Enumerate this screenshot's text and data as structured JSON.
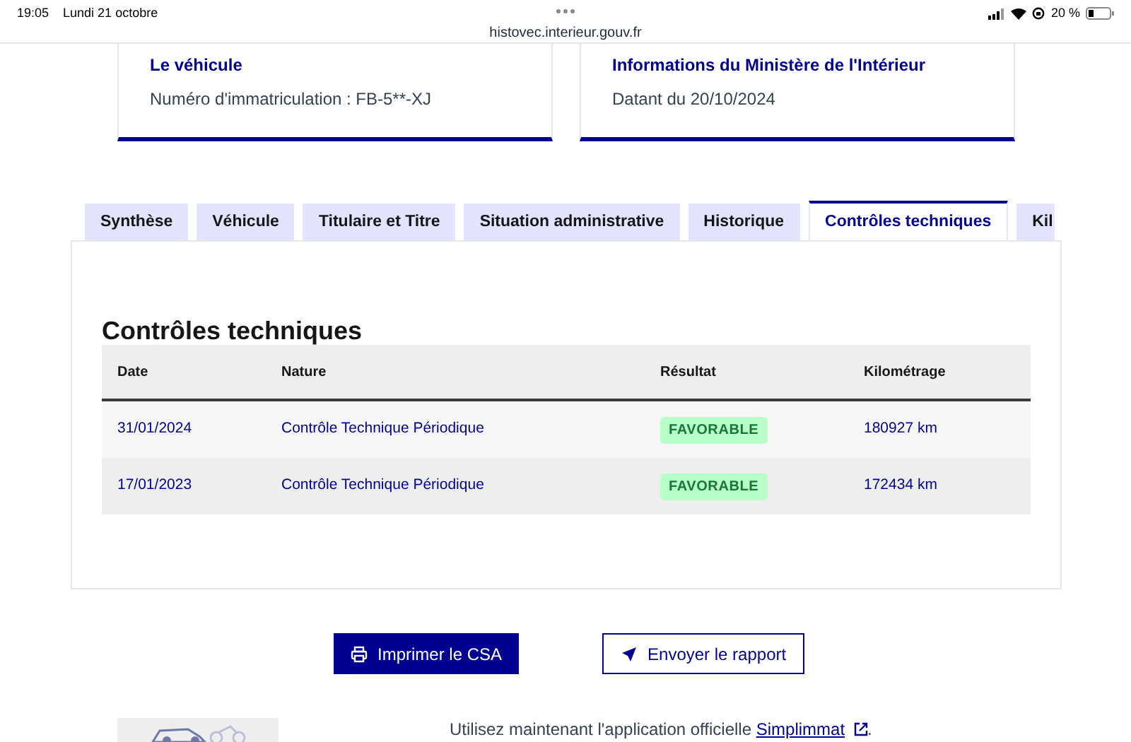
{
  "status_bar": {
    "time": "19:05",
    "date": "Lundi 21 octobre",
    "battery": "20 %",
    "url": "histovec.interieur.gouv.fr"
  },
  "cards": [
    {
      "title": "Le véhicule",
      "text": "Numéro d'immatriculation : FB-5**-XJ"
    },
    {
      "title": "Informations du Ministère de l'Intérieur",
      "text": "Datant du 20/10/2024"
    }
  ],
  "tabs": [
    {
      "label": "Synthèse",
      "selected": false
    },
    {
      "label": "Véhicule",
      "selected": false
    },
    {
      "label": "Titulaire et Titre",
      "selected": false
    },
    {
      "label": "Situation administrative",
      "selected": false
    },
    {
      "label": "Historique",
      "selected": false
    },
    {
      "label": "Contrôles techniques",
      "selected": true
    },
    {
      "label": "Kil",
      "selected": false
    }
  ],
  "section": {
    "title": "Contrôles techniques",
    "table": {
      "columns": [
        "Date",
        "Nature",
        "Résultat",
        "Kilométrage"
      ],
      "rows": [
        {
          "date": "31/01/2024",
          "nature": "Contrôle Technique Périodique",
          "result": "FAVORABLE",
          "km": "180927 km"
        },
        {
          "date": "17/01/2023",
          "nature": "Contrôle Technique Périodique",
          "result": "FAVORABLE",
          "km": "172434 km"
        }
      ]
    }
  },
  "buttons": [
    {
      "label": "Imprimer le CSA",
      "kind": "primary"
    },
    {
      "label": "Envoyer le rapport",
      "kind": "secondary"
    }
  ],
  "promo": {
    "text": "Utilisez maintenant l'application officielle",
    "link": "Simplimmat",
    "suffix": "."
  }
}
